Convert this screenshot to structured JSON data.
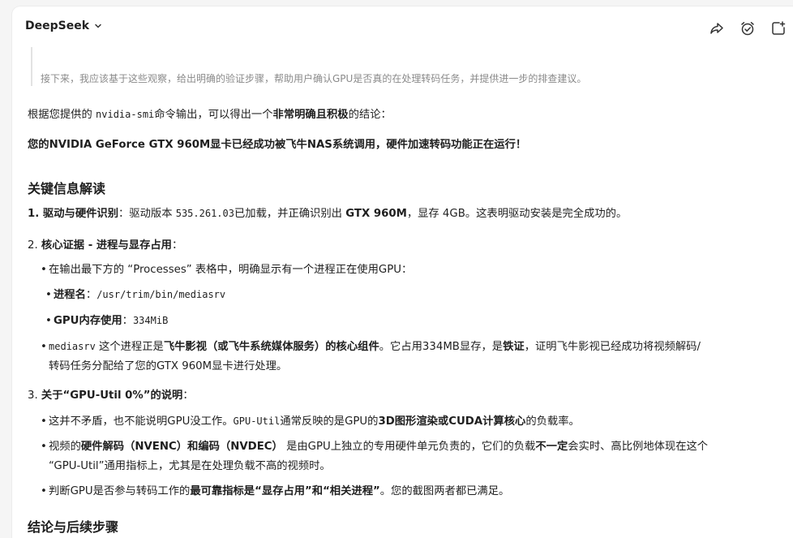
{
  "header": {
    "brand": "DeepSeek",
    "icons": [
      "share-icon",
      "alarm-icon",
      "new-chat-icon"
    ]
  },
  "think": "接下来，我应该基于这些观察，给出明确的验证步骤，帮助用户确认GPU是否真的在处理转码任务，并提供进一步的排查建议。",
  "intro": {
    "p1_a": "根据您提供的 ",
    "p1_code": "nvidia-smi",
    "p1_b": "命令输出，可以得出一个",
    "p1_bold": "非常明确且积极",
    "p1_c": "的结论：",
    "conclusion": "您的NVIDIA GeForce GTX 960M显卡已经成功被飞牛NAS系统调用，硬件加速转码功能正在运行！"
  },
  "section1": {
    "title": "关键信息解读",
    "item1": {
      "label": "1. 驱动与硬件识别",
      "a": "：驱动版本 ",
      "code": "535.261.03",
      "b": "已加载，并正确识别出 ",
      "bold": "GTX 960M",
      "c": "，显存 4GB。这表明驱动安装是完全成功的。"
    },
    "item2": {
      "num": "2. ",
      "label": "核心证据 - 进程与显存占用",
      "colon": "：",
      "b1": "在输出最下方的 “Processes” 表格中，明确显示有一个进程正在使用GPU：",
      "sub1_label": "进程名",
      "sub1_colon": "：",
      "sub1_code": "/usr/trim/bin/mediasrv",
      "sub2_label": "GPU内存使用",
      "sub2_colon": "：",
      "sub2_code": "334MiB",
      "b2_code": "mediasrv",
      "b2_a": " 这个进程正是",
      "b2_bold1": "飞牛影视（或飞牛系统媒体服务）的核心组件",
      "b2_b": "。它占用334MB显存，是",
      "b2_bold2": "铁证",
      "b2_c": "，证明飞牛影视已经成功将视频解码/",
      "b2_line2": "转码任务分配给了您的GTX 960M显卡进行处理。"
    },
    "item3": {
      "num": "3. ",
      "label": "关于“GPU-Util 0%”的说明",
      "colon": "：",
      "b1_a": "这并不矛盾，也不能说明GPU没工作。",
      "b1_code": "GPU-Util",
      "b1_b": "通常反映的是GPU的",
      "b1_bold": "3D图形渲染或CUDA计算核心",
      "b1_c": "的负载率。",
      "b2_a": "视频的",
      "b2_bold1": "硬件解码（NVENC）和编码（NVDEC）",
      "b2_b": " 是由GPU上独立的专用硬件单元负责的，它们的负载",
      "b2_bold2": "不一定",
      "b2_c": "会实时、高比例地体现在这个",
      "b2_line2": "“GPU-Util”通用指标上，尤其是在处理负载不高的视频时。",
      "b3_a": "判断GPU是否参与转码工作的",
      "b3_bold": "最可靠指标是“显存占用”和“相关进程”",
      "b3_b": "。您的截图两者都已满足。"
    }
  },
  "section2": {
    "title": "结论与后续步骤"
  },
  "bullet": "•"
}
